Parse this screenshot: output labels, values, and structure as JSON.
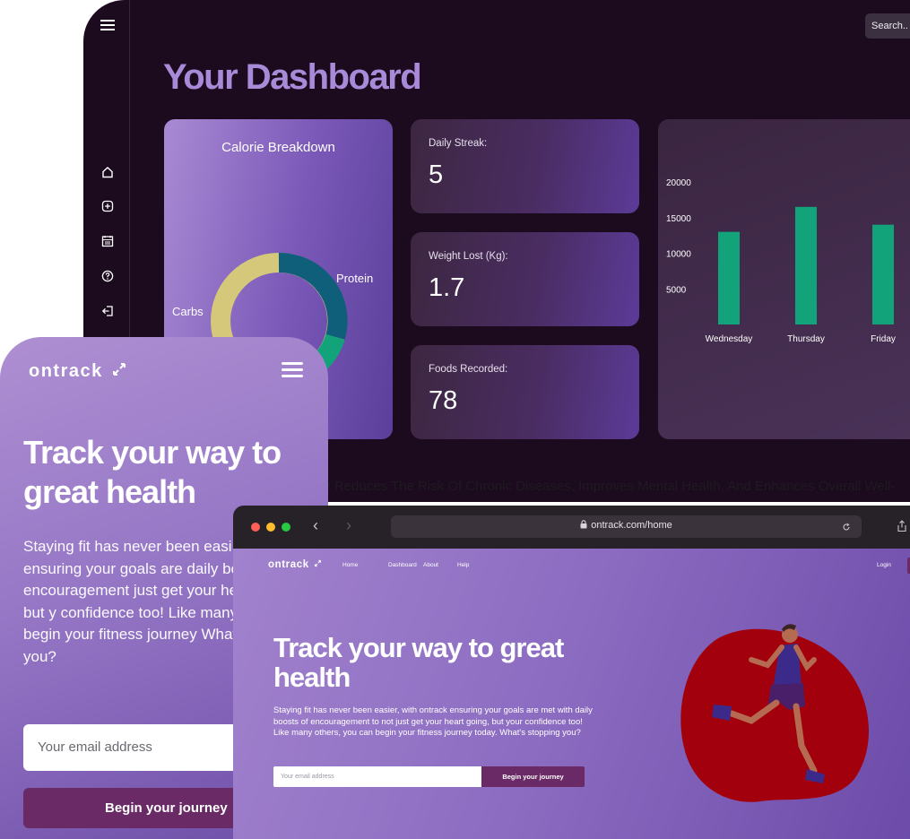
{
  "dashboard": {
    "title": "Your Dashboard",
    "search_label": "Search..",
    "sidebar_icons": [
      "menu-icon",
      "home-icon",
      "add-square-icon",
      "calendar-icon",
      "help-icon",
      "logout-icon"
    ],
    "calorie_card": {
      "title": "Calorie Breakdown",
      "labels": [
        "Carbs",
        "Protein"
      ],
      "colors": {
        "carbs": "#d6c87a",
        "protein": "#0f5e7a",
        "fat": "#12a37a"
      }
    },
    "stats": [
      {
        "label": "Daily Streak:",
        "value": "5"
      },
      {
        "label": "Weight Lost (Kg):",
        "value": "1.7"
      },
      {
        "label": "Foods Recorded:",
        "value": "78"
      }
    ]
  },
  "chart_data": {
    "type": "bar",
    "categories": [
      "Wednesday",
      "Thursday",
      "Friday"
    ],
    "values": [
      13000,
      16500,
      14000
    ],
    "y_ticks": [
      "5000",
      "10000",
      "15000",
      "20000"
    ],
    "ylim": [
      0,
      20000
    ],
    "bar_color": "#12a37a"
  },
  "tagline": "ty Reduces The Risk Of Chronic Diseases, Improves Mental Health, And Enhances Overall Well-",
  "mobile": {
    "logo": "ontrack",
    "headline": "Track your way to great health",
    "description": "Staying fit has never been easi ontrack ensuring your goals are daily boosts of encouragement just get your heart going, but y confidence too! Like many othe can begin your fitness journey What's stopping you?",
    "email_placeholder": "Your email address",
    "cta": "Begin your journey"
  },
  "browser": {
    "url": "ontrack.com/home",
    "site": {
      "logo": "ontrack",
      "nav": [
        "Home",
        "Dashboard",
        "About",
        "Help"
      ],
      "login": "Login",
      "headline": "Track your way to great health",
      "description": "Staying fit has never been easier, with ontrack ensuring your goals are met with daily boosts of encouragement to not just get your heart going, but your confidence too! Like many others, you can begin your fitness journey today. What's stopping you?",
      "email_placeholder": "Your email address",
      "cta": "Begin your journey"
    }
  },
  "colors": {
    "accent": "#6a2a66",
    "brand_purple": "#a98ad8",
    "dashboard_bg": "#1c0a1e",
    "runner_blob": "#a3000e"
  }
}
